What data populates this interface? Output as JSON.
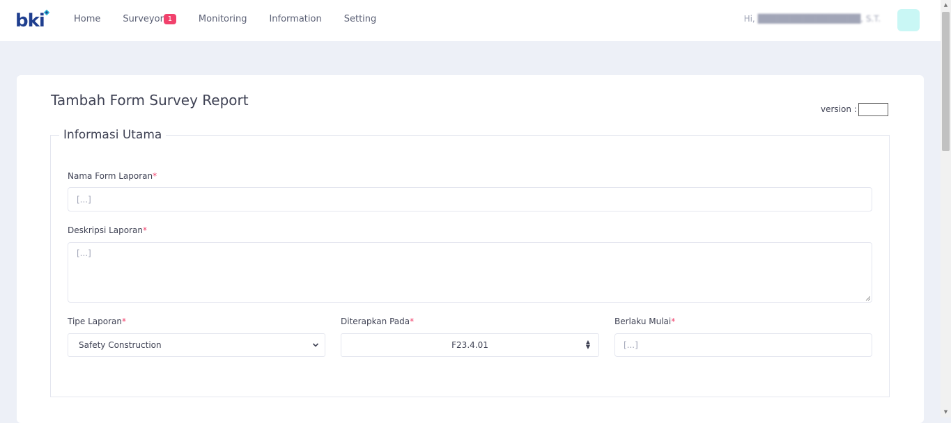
{
  "header": {
    "logo_text": "bki",
    "nav": [
      {
        "label": "Home"
      },
      {
        "label": "Surveyor",
        "badge": "1"
      },
      {
        "label": "Monitoring"
      },
      {
        "label": "Information"
      },
      {
        "label": "Setting"
      }
    ],
    "greeting": "Hi,",
    "user_name": "████████████████, S.T."
  },
  "page": {
    "title": "Tambah Form Survey Report",
    "version_label": "version :",
    "version_value": ""
  },
  "section": {
    "legend": "Informasi Utama",
    "fields": {
      "nama_form": {
        "label": "Nama Form Laporan",
        "required": "*",
        "placeholder": "[...]"
      },
      "deskripsi": {
        "label": "Deskripsi Laporan",
        "required": "*",
        "placeholder": "[...]"
      },
      "tipe": {
        "label": "Tipe Laporan",
        "required": "*",
        "value": "Safety Construction"
      },
      "diterapkan": {
        "label": "Diterapkan Pada",
        "required": "*",
        "value": "F23.4.01"
      },
      "berlaku": {
        "label": "Berlaku Mulai",
        "required": "*",
        "placeholder": "[...]"
      }
    }
  },
  "colors": {
    "accent": "#1f3f8f",
    "badge": "#f1416c",
    "required": "#f1416c",
    "avatar": "#c9f7f5",
    "background": "#edf0f7"
  },
  "icons": {
    "logo_dot": "diamond-icon",
    "select_arrow": "chevron-down-icon",
    "number_arrows": "up-down-arrows-icon"
  }
}
